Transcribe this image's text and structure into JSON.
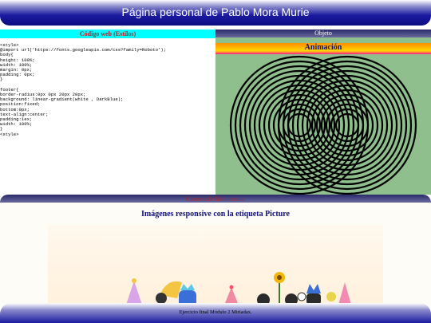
{
  "header": {
    "title": "Página personal de Pablo Mora Murie"
  },
  "left_panel": {
    "title": "Código web (Estilos)",
    "code": "<style>\n@import url('https://fonts.googleapis.com/css?family=Roboto');\nbody{\nheight: 100%;\nwidth: 100%;\nmargin: 0px;\npadding: 0px;\n}\n\nfooter{\nborder-radius:0px 0px 20px 20px;\nbackground: linear-gradient(white , DarkBlue);\nposition:fixed;\nbottom:0px;\ntext-align:center;\npadding:1ex;\nwidth: 100%;\n}\n<style>"
  },
  "right_panel": {
    "title": "Objeto",
    "animation_title": "Animación"
  },
  "multimedia": {
    "bar_label": "Contenido Multimedia",
    "title": "Imágenes responsive con la etiqueta Picture"
  },
  "footer": {
    "text": "Ejercicio final Módulo 2 Miriadax."
  },
  "colors": {
    "header_blue": "#0d0d80",
    "left_title_bg": "#00ffff",
    "right_bg": "#8fbf8c",
    "section_title": "#10107a"
  }
}
